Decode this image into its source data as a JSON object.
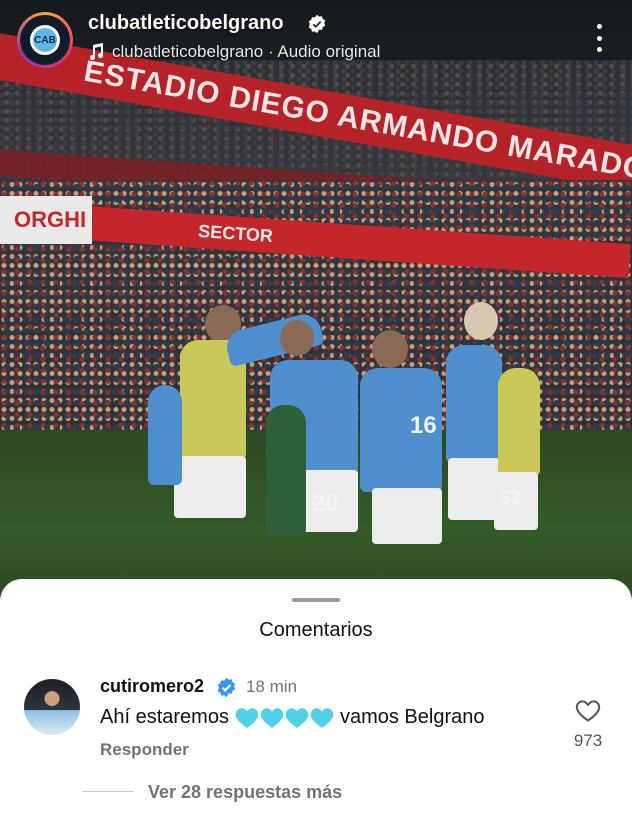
{
  "header": {
    "username": "clubatleticobelgrano",
    "audio_label": "clubatleticobelgrano · Audio original"
  },
  "video": {
    "banner_text": "ESTADIO DIEGO ARMANDO MARADONA",
    "ad_text": "SECTOR",
    "left_sign_text": "ORGHI",
    "jersey_numbers": [
      "16",
      "20",
      "53"
    ]
  },
  "comments": {
    "title": "Comentarios",
    "items": [
      {
        "username": "cutiromero2",
        "time": "18 min",
        "text_before": "Ahí estaremos",
        "emoji_hearts": "💙💙💙💙",
        "text_after": "vamos Belgrano",
        "reply_label": "Responder",
        "like_count": "973",
        "view_replies_label": "Ver 28 respuestas más"
      }
    ]
  },
  "colors": {
    "verified_blue": "#3797f0",
    "heart_cyan": "#4fd1e8",
    "muted_text": "#737373",
    "stadium_red": "#c4262c"
  },
  "icons": [
    "verified-icon",
    "music-note-icon",
    "more-options-icon",
    "heart-outline-icon",
    "cyan-heart-emoji"
  ]
}
